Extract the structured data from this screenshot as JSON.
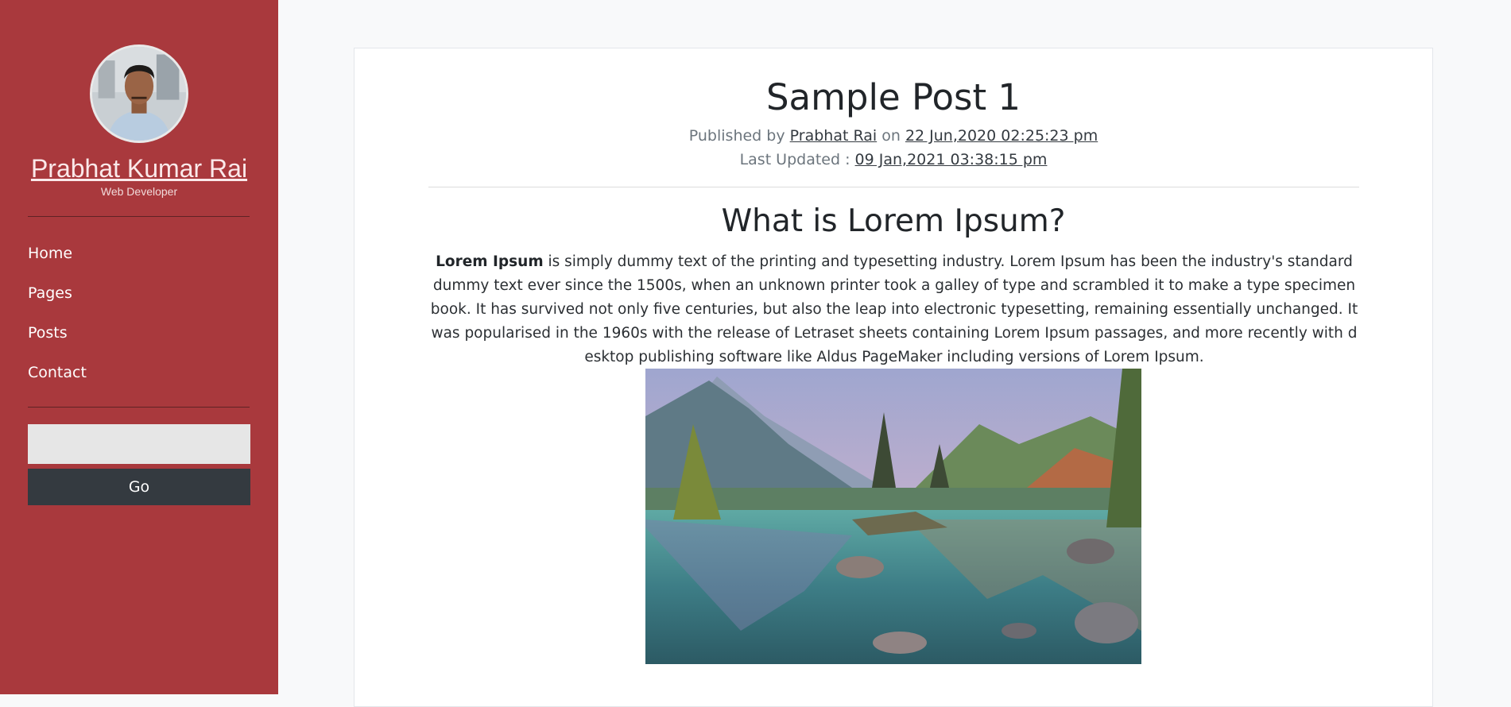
{
  "sidebar": {
    "name": "Prabhat Kumar Rai",
    "role": "Web Developer",
    "nav": [
      {
        "label": "Home"
      },
      {
        "label": "Pages"
      },
      {
        "label": "Posts"
      },
      {
        "label": "Contact"
      }
    ],
    "search": {
      "value": "",
      "placeholder": ""
    },
    "go_label": "Go"
  },
  "post": {
    "title": "Sample Post 1",
    "published_prefix": "Published by",
    "author": "Prabhat Rai",
    "on_word": "on",
    "published_date": "22 Jun,2020 02:25:23 pm",
    "updated_prefix": "Last Updated :",
    "updated_date": "09 Jan,2021 03:38:15 pm",
    "heading": "What is Lorem Ipsum?",
    "body_bold": "Lorem Ipsum",
    "body_text": " is simply dummy text of the printing and typesetting industry. Lorem Ipsum has been the industry's standard dummy text ever since the 1500s, when an unknown printer took a galley of type and scrambled it to make a type specimen book. It has survived not only five centuries, but also the leap into electronic typesetting, remaining essentially unchanged. It was popularised in the 1960s with the release of Letraset sheets containing Lorem Ipsum passages, and more recently with desktop publishing software like Aldus PageMaker including versions of Lorem Ipsum."
  },
  "colors": {
    "sidebar_bg": "#a9393d",
    "page_bg": "#f8f9fa",
    "button_bg": "#343a40"
  }
}
